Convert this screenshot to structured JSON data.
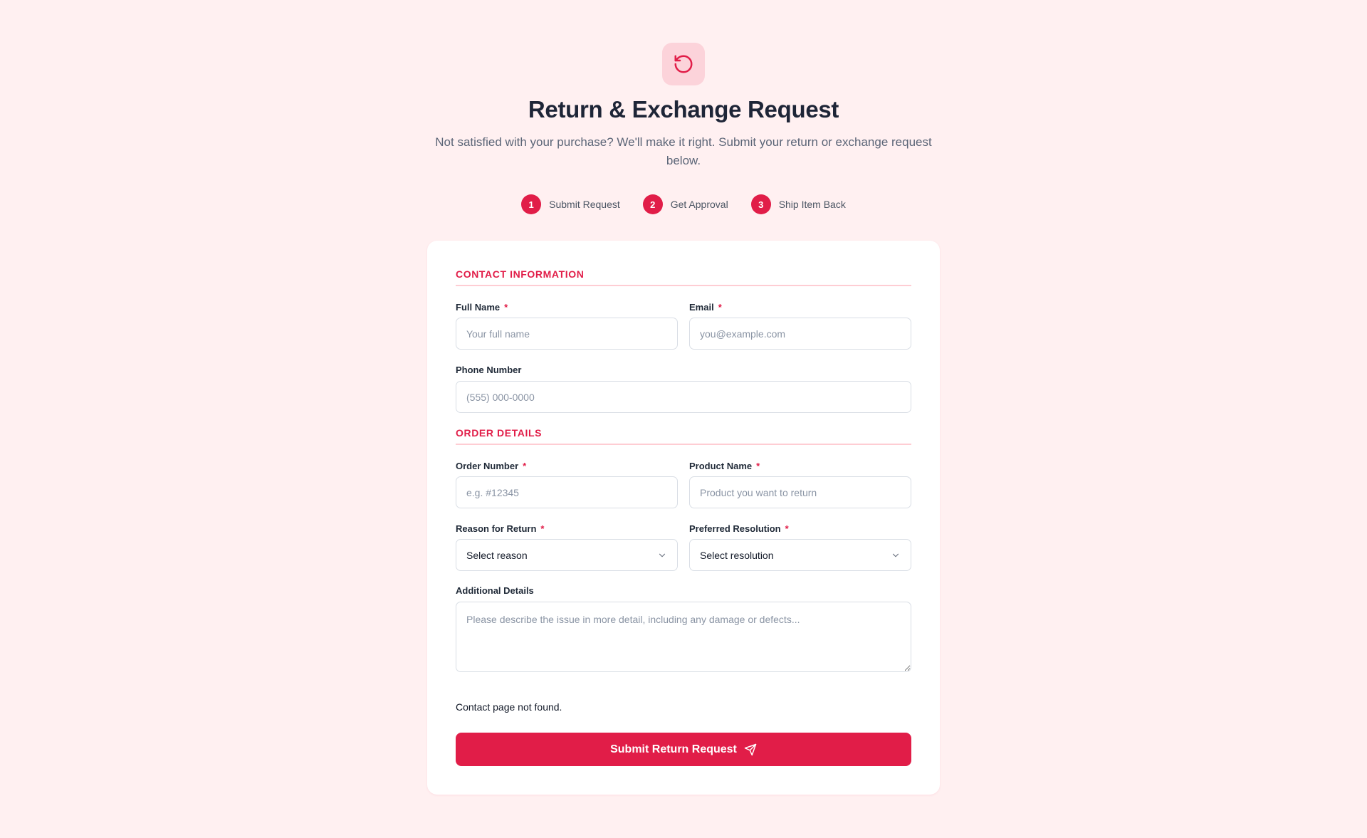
{
  "header": {
    "icon": "undo-icon",
    "title": "Return & Exchange Request",
    "subtitle": "Not satisfied with your purchase? We'll make it right. Submit your return or exchange request below."
  },
  "steps": [
    {
      "number": "1",
      "label": "Submit Request"
    },
    {
      "number": "2",
      "label": "Get Approval"
    },
    {
      "number": "3",
      "label": "Ship Item Back"
    }
  ],
  "contact": {
    "section_title": "CONTACT INFORMATION",
    "full_name": {
      "label": "Full Name",
      "required": "*",
      "value": "",
      "placeholder": "Your full name"
    },
    "email": {
      "label": "Email",
      "required": "*",
      "value": "",
      "placeholder": "you@example.com"
    },
    "phone": {
      "label": "Phone Number",
      "value": "",
      "placeholder": "(555) 000-0000"
    }
  },
  "order": {
    "section_title": "ORDER DETAILS",
    "order_number": {
      "label": "Order Number",
      "required": "*",
      "value": "",
      "placeholder": "e.g. #12345"
    },
    "product_name": {
      "label": "Product Name",
      "required": "*",
      "value": "",
      "placeholder": "Product you want to return"
    },
    "reason": {
      "label": "Reason for Return",
      "required": "*",
      "selected": "Select reason"
    },
    "resolution": {
      "label": "Preferred Resolution",
      "required": "*",
      "selected": "Select resolution"
    },
    "details": {
      "label": "Additional Details",
      "value": "",
      "placeholder": "Please describe the issue in more detail, including any damage or defects..."
    }
  },
  "notice": "Contact page not found.",
  "submit": {
    "label": "Submit Return Request",
    "icon": "send-icon"
  },
  "colors": {
    "accent": "#e11d48",
    "background": "#fff0f1",
    "icon_bg": "#fcd3da"
  }
}
